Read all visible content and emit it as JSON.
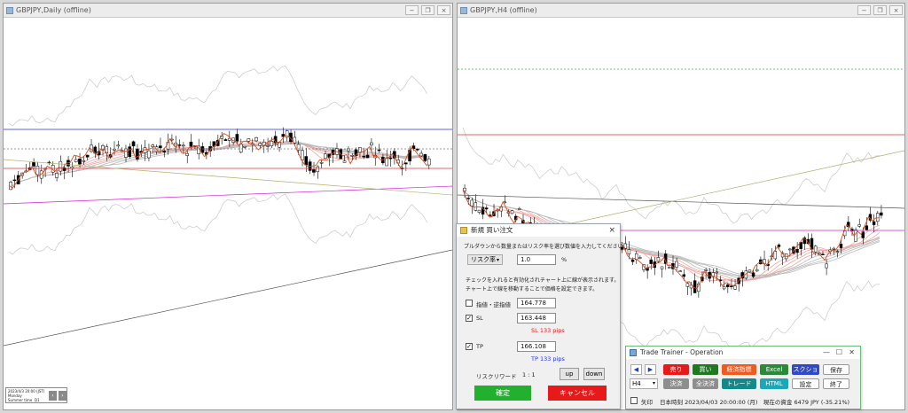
{
  "left_window": {
    "title": "GBPJPY,Daily (offline)",
    "info_lines": [
      "2023/4/3 20:00 (JST)",
      "Monday",
      "Summer time"
    ],
    "info_tag": "D1"
  },
  "right_window": {
    "title": "GBPJPY,H4 (offline)"
  },
  "window_controls": {
    "minimize": "−",
    "restore": "❐",
    "close": "×"
  },
  "order_dialog": {
    "title": "新規 買い注文",
    "close": "×",
    "instruction": "プルダウンから数量またはリスク率を選び数値を入力してください。",
    "risk_select": "リスク率",
    "risk_value": "1.0",
    "risk_unit": "%",
    "note_line1": "チェックを入れると有効化されチャート上に線が表示されます。",
    "note_line2": "チャート上で線を移動することで価格を設定できます。",
    "stop_label": "指値・逆指値",
    "stop_value": "164.778",
    "sl_label": "SL",
    "sl_value": "163.448",
    "sl_pips": "SL 133 pips",
    "tp_label": "TP",
    "tp_value": "166.108",
    "tp_pips": "TP 133 pips",
    "risk_reward_label": "リスクリワード",
    "risk_reward_value": "1 : 1",
    "up": "up",
    "down": "down",
    "confirm": "確定",
    "cancel": "キャンセル",
    "colors": {
      "confirm": "#22b12f",
      "cancel": "#e8191b",
      "sl": "#e02020",
      "tp": "#2436d8"
    }
  },
  "trainer": {
    "title": "Trade Trainer - Operation",
    "timeframe": "H4",
    "row1": [
      {
        "label": "売り",
        "color": "#e8191b"
      },
      {
        "label": "買い",
        "color": "#1f7a1f"
      },
      {
        "label": "経済指標",
        "color": "#ef5a1e"
      },
      {
        "label": "Excel",
        "color": "#2a8a3a"
      },
      {
        "label": "スクショ",
        "color": "#2f49c8"
      },
      {
        "label": "保存",
        "color": "#ffffff"
      }
    ],
    "row2": [
      {
        "label": "決済",
        "color": "#8e8e8e"
      },
      {
        "label": "全決済",
        "color": "#8e8e8e"
      },
      {
        "label": "トレード",
        "color": "#138a8a"
      },
      {
        "label": "HTML",
        "color": "#1aa8b8"
      },
      {
        "label": "設定",
        "color": "#ffffff"
      },
      {
        "label": "終了",
        "color": "#ffffff"
      }
    ],
    "arrow_label": "矢印",
    "status": "日本時刻 2023/04/03 20:00:00 (月)　現在の資金 6479 JPY (-35.21%)"
  }
}
